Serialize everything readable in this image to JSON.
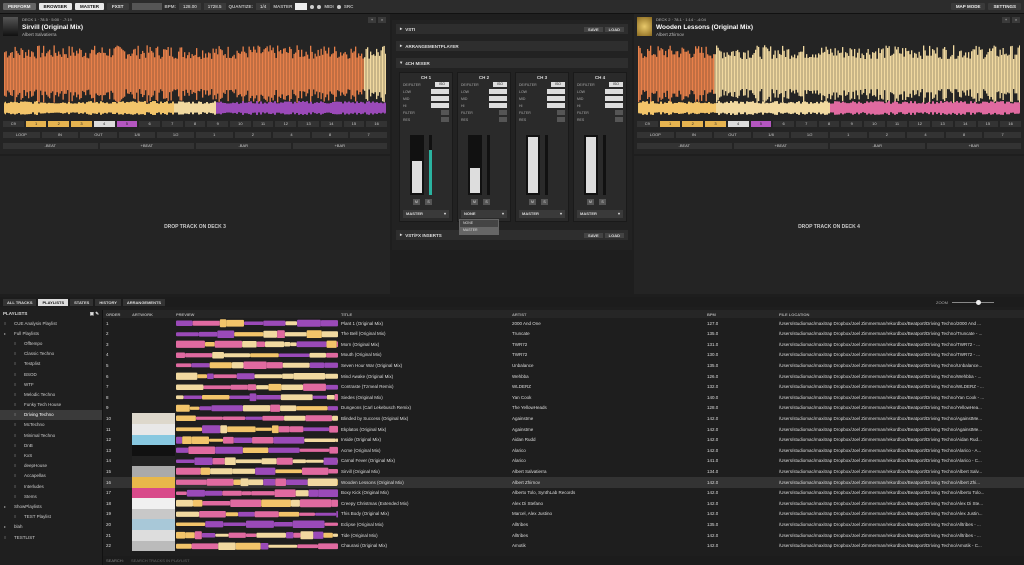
{
  "topbar": {
    "mode": "PERFORM",
    "browser": "BROWSER",
    "master": "MASTER",
    "fxst": "FXST",
    "bpm_label": "BPM:",
    "bpm_value": "128.00",
    "pitch_value": "1728.5",
    "quantize_label": "QUANTIZE:",
    "quantize_value": "1/4",
    "master_label": "MASTER",
    "midi_label": "MIDI",
    "src_label": "SRC",
    "map_mode": "MAP MODE",
    "settings": "SETTINGS"
  },
  "deck1": {
    "meta": "DECK 1  ·  78.5  ·  5:00  ·  -7:19",
    "title": "Sirvill (Original Mix)",
    "artist": "Albert Salvatierra",
    "cue_buttons": [
      "C9",
      "1",
      "2",
      "3",
      "4",
      "5",
      "6",
      "7",
      "8",
      "9",
      "10",
      "11",
      "12",
      "13",
      "14",
      "15",
      "16"
    ],
    "loop_row": [
      "LOOP",
      "IN",
      "OUT",
      "1/8",
      "1/2",
      "1",
      "2",
      "4",
      "8",
      "7"
    ],
    "beat_row": [
      "-BEAT",
      "+BEAT",
      "-BAR",
      "+BAR"
    ]
  },
  "deck2": {
    "meta": "DECK 2  ·  78.1  ·  1:14  ·  -4:04",
    "title": "Wooden Lessons (Original Mix)",
    "artist": "Albert Zhirnov",
    "cue_buttons": [
      "C9",
      "1",
      "2",
      "3",
      "4",
      "5",
      "6",
      "7",
      "8",
      "9",
      "10",
      "11",
      "12",
      "13",
      "14",
      "15",
      "16"
    ],
    "loop_row": [
      "LOOP",
      "IN",
      "OUT",
      "1/8",
      "1/2",
      "1",
      "2",
      "4",
      "8",
      "7"
    ],
    "beat_row": [
      "-BEAT",
      "+BEAT",
      "-BAR",
      "+BAR"
    ]
  },
  "deck3": {
    "drop": "DROP TRACK ON DECK 3"
  },
  "deck4": {
    "drop": "DROP TRACK ON DECK 4"
  },
  "center": {
    "vsti": "VSTI",
    "save": "SAVE",
    "load": "LOAD",
    "arrangement": "ARRANGEMENTPLAYER",
    "mixer": "4CH MIXER",
    "vstfx": "VST/FX INSERTS",
    "channels": [
      {
        "name": "CH 1",
        "filter_label": "DE/FILTER",
        "filter_value": "ISO",
        "fader": 0.58,
        "meter": 0.75,
        "route": "MASTER"
      },
      {
        "name": "CH 2",
        "filter_label": "DE/FILTER",
        "filter_value": "ISO",
        "fader": 0.45,
        "meter": 0.0,
        "route": "NONE"
      },
      {
        "name": "CH 3",
        "filter_label": "DE/FILTER",
        "filter_value": "ISO",
        "fader": 1.0,
        "meter": 0.0,
        "route": "MASTER"
      },
      {
        "name": "CH 4",
        "filter_label": "DE/FILTER",
        "filter_value": "ISO",
        "fader": 1.0,
        "meter": 0.0,
        "route": "MASTER"
      }
    ],
    "knob_rows": [
      "LOW",
      "MID",
      "HI",
      "FILTER",
      "RES"
    ],
    "dropdown_options": [
      "NONE",
      "MASTER"
    ]
  },
  "browser": {
    "tabs": [
      "ALL TRACKS",
      "PLAYLISTS",
      "STATES",
      "HISTORY",
      "ARRANGEMENTS"
    ],
    "zoom_label": "ZOOM",
    "playlists_header": "PLAYLISTS",
    "search_label": "SEARCH:",
    "search_placeholder": "SEARCH TRACKS IN PLAYLIST",
    "columns": {
      "order": "ORDER",
      "artwork": "ARTWORK",
      "preview": "PREVIEW",
      "title": "TITLE",
      "artist": "ARTIST",
      "bpm": "BPM",
      "location": "FILE LOCATION"
    }
  },
  "playlists": [
    {
      "label": "CUE Analysis Playlist",
      "indent": 1,
      "icon": "≡"
    },
    {
      "label": "Full Playlists",
      "indent": 1,
      "icon": "▸"
    },
    {
      "label": "Offtempo",
      "indent": 2,
      "icon": "≡"
    },
    {
      "label": "Classic Techno",
      "indent": 2,
      "icon": "≡"
    },
    {
      "label": "Testplist",
      "indent": 2,
      "icon": "≡"
    },
    {
      "label": "BSOD",
      "indent": 2,
      "icon": "≡"
    },
    {
      "label": "WTF",
      "indent": 2,
      "icon": "≡"
    },
    {
      "label": "Melodic Techno",
      "indent": 2,
      "icon": "≡"
    },
    {
      "label": "Funky Tech House",
      "indent": 2,
      "icon": "≡"
    },
    {
      "label": "Driving Techno",
      "indent": 2,
      "icon": "≡",
      "selected": true
    },
    {
      "label": "McTechno",
      "indent": 2,
      "icon": "≡"
    },
    {
      "label": "Minimal Techno",
      "indent": 2,
      "icon": "≡"
    },
    {
      "label": "DnB",
      "indent": 2,
      "icon": "≡"
    },
    {
      "label": "KxS",
      "indent": 2,
      "icon": "≡"
    },
    {
      "label": "deepHouse",
      "indent": 2,
      "icon": "≡"
    },
    {
      "label": "Accapellas",
      "indent": 2,
      "icon": "≡"
    },
    {
      "label": "Interludes",
      "indent": 2,
      "icon": "≡"
    },
    {
      "label": "Stems",
      "indent": 2,
      "icon": "≡"
    },
    {
      "label": "ShowPlaylists",
      "indent": 1,
      "icon": "▸"
    },
    {
      "label": "TEST Playlist",
      "indent": 2,
      "icon": "≡"
    },
    {
      "label": "blah",
      "indent": 1,
      "icon": "▸"
    },
    {
      "label": "TESTLIST",
      "indent": 1,
      "icon": "≡"
    }
  ],
  "tracks": [
    {
      "order": "1",
      "title": "Plant 1 (Original Mix)",
      "artist": "2000 And One",
      "bpm": "127.0",
      "location": "/Users/studiomac/maxitrap Dropbox/Joel Zimmerman/rekordbox/Beatport/Driving Techno/2000 And ..."
    },
    {
      "order": "2",
      "title": "The Bell (Original Mix)",
      "artist": "Truncate",
      "bpm": "135.0",
      "location": "/Users/studiomac/maxitrap Dropbox/Joel Zimmerman/rekordbox/Beatport/Driving Techno/Truncate - ..."
    },
    {
      "order": "3",
      "title": "Morn (Original Mix)",
      "artist": "TWR72",
      "bpm": "131.0",
      "location": "/Users/studiomac/maxitrap Dropbox/Joel Zimmerman/rekordbox/Beatport/Driving Techno/TWR72 - ..."
    },
    {
      "order": "4",
      "title": "Mouth (Original Mix)",
      "artist": "TWR72",
      "bpm": "130.0",
      "location": "/Users/studiomac/maxitrap Dropbox/Joel Zimmerman/rekordbox/Beatport/Driving Techno/TWR72 - ..."
    },
    {
      "order": "5",
      "title": "Seven Hour War (Original Mix)",
      "artist": "Unbalance",
      "bpm": "135.0",
      "location": "/Users/studiomac/maxitrap Dropbox/Joel Zimmerman/rekordbox/Beatport/Driving Techno/Unbalance..."
    },
    {
      "order": "6",
      "title": "Mind Awake (Original Mix)",
      "artist": "Wehbba",
      "bpm": "126.0",
      "location": "/Users/studiomac/maxitrap Dropbox/Joel Zimmerman/rekordbox/Beatport/Driving Techno/Wehbba - ..."
    },
    {
      "order": "7",
      "title": "Contraste (Tzmeal Remix)",
      "artist": "WLDERZ",
      "bpm": "132.0",
      "location": "/Users/studiomac/maxitrap Dropbox/Joel Zimmerman/rekordbox/Beatport/Driving Techno/WLDERZ - ..."
    },
    {
      "order": "8",
      "title": "Siedes (Original Mix)",
      "artist": "Yan Cook",
      "bpm": "140.0",
      "location": "/Users/studiomac/maxitrap Dropbox/Joel Zimmerman/rekordbox/Beatport/Driving Techno/Yan Cook - ..."
    },
    {
      "order": "9",
      "title": "Dungeons (Carl Lekebusch Remix)",
      "artist": "The YellowHeads",
      "bpm": "128.0",
      "location": "/Users/studiomac/maxitrap Dropbox/Joel Zimmerman/rekordbox/Beatport/Driving Techno/YellowHea..."
    },
    {
      "order": "10",
      "title": "Blinded by Success (Original Mix)",
      "artist": "Againstme",
      "bpm": "142.0",
      "location": "/Users/studiomac/maxitrap Dropbox/Joel Zimmerman/rekordbox/Beatport/Driving Techno/AgainstMe..."
    },
    {
      "order": "11",
      "title": "Ekplatos (Original Mix)",
      "artist": "Againstme",
      "bpm": "142.0",
      "location": "/Users/studiomac/maxitrap Dropbox/Joel Zimmerman/rekordbox/Beatport/Driving Techno/AgainstMe..."
    },
    {
      "order": "12",
      "title": "Inside (Original Mix)",
      "artist": "Aidan Rudd",
      "bpm": "142.0",
      "location": "/Users/studiomac/maxitrap Dropbox/Joel Zimmerman/rekordbox/Beatport/Driving Techno/Aidan Rud..."
    },
    {
      "order": "13",
      "title": "Acme (Original Mix)",
      "artist": "Alarico",
      "bpm": "142.0",
      "location": "/Users/studiomac/maxitrap Dropbox/Joel Zimmerman/rekordbox/Beatport/Driving Techno/Alarico - A..."
    },
    {
      "order": "14",
      "title": "Carnal Fever (Original Mix)",
      "artist": "Alarico",
      "bpm": "141.0",
      "location": "/Users/studiomac/maxitrap Dropbox/Joel Zimmerman/rekordbox/Beatport/Driving Techno/Alarico - C..."
    },
    {
      "order": "15",
      "title": "Sirvill (Original Mix)",
      "artist": "Albert Salvatierra",
      "bpm": "134.0",
      "location": "/Users/studiomac/maxitrap Dropbox/Joel Zimmerman/rekordbox/Beatport/Driving Techno/Albert Salv..."
    },
    {
      "order": "16",
      "title": "Wooden Lessons (Original Mix)",
      "artist": "Albert Zhirnov",
      "bpm": "142.0",
      "location": "/Users/studiomac/maxitrap Dropbox/Joel Zimmerman/rekordbox/Beatport/Driving Techno/Albert Zhi...",
      "selected": true
    },
    {
      "order": "17",
      "title": "Boxy Kick (Original Mix)",
      "artist": "Alberto Tolo, SynthLab Records",
      "bpm": "142.0",
      "location": "/Users/studiomac/maxitrap Dropbox/Joel Zimmerman/rekordbox/Beatport/Driving Techno/Alberto Tolo..."
    },
    {
      "order": "18",
      "title": "Creepy Christmas (Extended Mix)",
      "artist": "Alex Di Stefano",
      "bpm": "142.0",
      "location": "/Users/studiomac/maxitrap Dropbox/Joel Zimmerman/rekordbox/Beatport/Driving Techno/Alex Di Ste..."
    },
    {
      "order": "19",
      "title": "This Body (Original Mix)",
      "artist": "Marcel, Alex Justino",
      "bpm": "142.0",
      "location": "/Users/studiomac/maxitrap Dropbox/Joel Zimmerman/rekordbox/Beatport/Driving Techno/Alex Justin..."
    },
    {
      "order": "20",
      "title": "Eclipse (Original Mix)",
      "artist": "Alltribes",
      "bpm": "135.0",
      "location": "/Users/studiomac/maxitrap Dropbox/Joel Zimmerman/rekordbox/Beatport/Driving Techno/Alltribes - ..."
    },
    {
      "order": "21",
      "title": "Tide (Original Mix)",
      "artist": "Alltribes",
      "bpm": "142.0",
      "location": "/Users/studiomac/maxitrap Dropbox/Joel Zimmerman/rekordbox/Beatport/Driving Techno/Alltribes - ..."
    },
    {
      "order": "22",
      "title": "Chaurasi (Original Mix)",
      "artist": "Amotik",
      "bpm": "142.0",
      "location": "/Users/studiomac/maxitrap Dropbox/Joel Zimmerman/rekordbox/Beatport/Driving Techno/Amotik - C..."
    }
  ],
  "colors": {
    "wave_orange": "#e8804a",
    "wave_cream": "#f1d9a0",
    "wave_yellow": "#f2c46a",
    "wave_pink": "#e06aa0",
    "wave_purple": "#9a4ab8",
    "accent_teal": "#2ab3a0"
  }
}
